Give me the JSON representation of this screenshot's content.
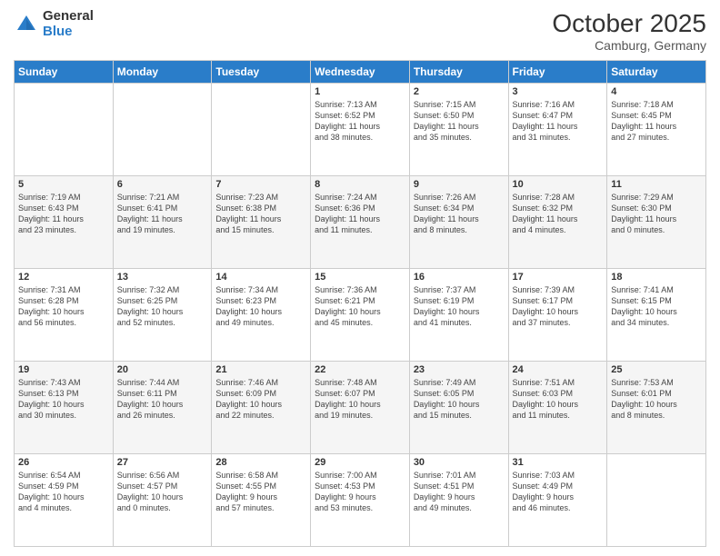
{
  "header": {
    "logo_general": "General",
    "logo_blue": "Blue",
    "month": "October 2025",
    "location": "Camburg, Germany"
  },
  "days_of_week": [
    "Sunday",
    "Monday",
    "Tuesday",
    "Wednesday",
    "Thursday",
    "Friday",
    "Saturday"
  ],
  "weeks": [
    [
      {
        "num": "",
        "info": ""
      },
      {
        "num": "",
        "info": ""
      },
      {
        "num": "",
        "info": ""
      },
      {
        "num": "1",
        "info": "Sunrise: 7:13 AM\nSunset: 6:52 PM\nDaylight: 11 hours\nand 38 minutes."
      },
      {
        "num": "2",
        "info": "Sunrise: 7:15 AM\nSunset: 6:50 PM\nDaylight: 11 hours\nand 35 minutes."
      },
      {
        "num": "3",
        "info": "Sunrise: 7:16 AM\nSunset: 6:47 PM\nDaylight: 11 hours\nand 31 minutes."
      },
      {
        "num": "4",
        "info": "Sunrise: 7:18 AM\nSunset: 6:45 PM\nDaylight: 11 hours\nand 27 minutes."
      }
    ],
    [
      {
        "num": "5",
        "info": "Sunrise: 7:19 AM\nSunset: 6:43 PM\nDaylight: 11 hours\nand 23 minutes."
      },
      {
        "num": "6",
        "info": "Sunrise: 7:21 AM\nSunset: 6:41 PM\nDaylight: 11 hours\nand 19 minutes."
      },
      {
        "num": "7",
        "info": "Sunrise: 7:23 AM\nSunset: 6:38 PM\nDaylight: 11 hours\nand 15 minutes."
      },
      {
        "num": "8",
        "info": "Sunrise: 7:24 AM\nSunset: 6:36 PM\nDaylight: 11 hours\nand 11 minutes."
      },
      {
        "num": "9",
        "info": "Sunrise: 7:26 AM\nSunset: 6:34 PM\nDaylight: 11 hours\nand 8 minutes."
      },
      {
        "num": "10",
        "info": "Sunrise: 7:28 AM\nSunset: 6:32 PM\nDaylight: 11 hours\nand 4 minutes."
      },
      {
        "num": "11",
        "info": "Sunrise: 7:29 AM\nSunset: 6:30 PM\nDaylight: 11 hours\nand 0 minutes."
      }
    ],
    [
      {
        "num": "12",
        "info": "Sunrise: 7:31 AM\nSunset: 6:28 PM\nDaylight: 10 hours\nand 56 minutes."
      },
      {
        "num": "13",
        "info": "Sunrise: 7:32 AM\nSunset: 6:25 PM\nDaylight: 10 hours\nand 52 minutes."
      },
      {
        "num": "14",
        "info": "Sunrise: 7:34 AM\nSunset: 6:23 PM\nDaylight: 10 hours\nand 49 minutes."
      },
      {
        "num": "15",
        "info": "Sunrise: 7:36 AM\nSunset: 6:21 PM\nDaylight: 10 hours\nand 45 minutes."
      },
      {
        "num": "16",
        "info": "Sunrise: 7:37 AM\nSunset: 6:19 PM\nDaylight: 10 hours\nand 41 minutes."
      },
      {
        "num": "17",
        "info": "Sunrise: 7:39 AM\nSunset: 6:17 PM\nDaylight: 10 hours\nand 37 minutes."
      },
      {
        "num": "18",
        "info": "Sunrise: 7:41 AM\nSunset: 6:15 PM\nDaylight: 10 hours\nand 34 minutes."
      }
    ],
    [
      {
        "num": "19",
        "info": "Sunrise: 7:43 AM\nSunset: 6:13 PM\nDaylight: 10 hours\nand 30 minutes."
      },
      {
        "num": "20",
        "info": "Sunrise: 7:44 AM\nSunset: 6:11 PM\nDaylight: 10 hours\nand 26 minutes."
      },
      {
        "num": "21",
        "info": "Sunrise: 7:46 AM\nSunset: 6:09 PM\nDaylight: 10 hours\nand 22 minutes."
      },
      {
        "num": "22",
        "info": "Sunrise: 7:48 AM\nSunset: 6:07 PM\nDaylight: 10 hours\nand 19 minutes."
      },
      {
        "num": "23",
        "info": "Sunrise: 7:49 AM\nSunset: 6:05 PM\nDaylight: 10 hours\nand 15 minutes."
      },
      {
        "num": "24",
        "info": "Sunrise: 7:51 AM\nSunset: 6:03 PM\nDaylight: 10 hours\nand 11 minutes."
      },
      {
        "num": "25",
        "info": "Sunrise: 7:53 AM\nSunset: 6:01 PM\nDaylight: 10 hours\nand 8 minutes."
      }
    ],
    [
      {
        "num": "26",
        "info": "Sunrise: 6:54 AM\nSunset: 4:59 PM\nDaylight: 10 hours\nand 4 minutes."
      },
      {
        "num": "27",
        "info": "Sunrise: 6:56 AM\nSunset: 4:57 PM\nDaylight: 10 hours\nand 0 minutes."
      },
      {
        "num": "28",
        "info": "Sunrise: 6:58 AM\nSunset: 4:55 PM\nDaylight: 9 hours\nand 57 minutes."
      },
      {
        "num": "29",
        "info": "Sunrise: 7:00 AM\nSunset: 4:53 PM\nDaylight: 9 hours\nand 53 minutes."
      },
      {
        "num": "30",
        "info": "Sunrise: 7:01 AM\nSunset: 4:51 PM\nDaylight: 9 hours\nand 49 minutes."
      },
      {
        "num": "31",
        "info": "Sunrise: 7:03 AM\nSunset: 4:49 PM\nDaylight: 9 hours\nand 46 minutes."
      },
      {
        "num": "",
        "info": ""
      }
    ]
  ]
}
